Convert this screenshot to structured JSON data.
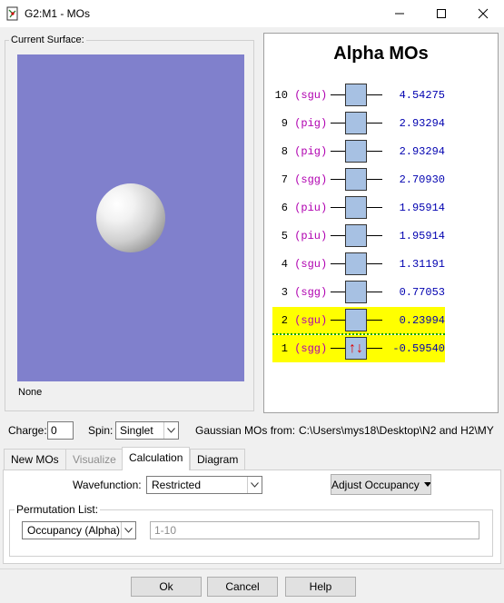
{
  "window": {
    "title": "G2:M1 - MOs"
  },
  "surface": {
    "legend": "Current Surface:",
    "status": "None"
  },
  "mo_panel": {
    "title": "Alpha MOs",
    "orbitals": [
      {
        "num": "10",
        "sym": "(sgu)",
        "energy": "4.54275",
        "occupied": false
      },
      {
        "num": "9",
        "sym": "(pig)",
        "energy": "2.93294",
        "occupied": false
      },
      {
        "num": "8",
        "sym": "(pig)",
        "energy": "2.93294",
        "occupied": false
      },
      {
        "num": "7",
        "sym": "(sgg)",
        "energy": "2.70930",
        "occupied": false
      },
      {
        "num": "6",
        "sym": "(piu)",
        "energy": "1.95914",
        "occupied": false
      },
      {
        "num": "5",
        "sym": "(piu)",
        "energy": "1.95914",
        "occupied": false
      },
      {
        "num": "4",
        "sym": "(sgu)",
        "energy": "1.31191",
        "occupied": false
      },
      {
        "num": "3",
        "sym": "(sgg)",
        "energy": "0.77053",
        "occupied": false
      },
      {
        "num": "2",
        "sym": "(sgu)",
        "energy": "0.23994",
        "occupied": false
      },
      {
        "num": "1",
        "sym": "(sgg)",
        "energy": "-0.59540",
        "occupied": true
      }
    ],
    "colors": {
      "highlight": "#ffff00",
      "symmetry": "#b000b0",
      "energy": "#0000b0",
      "box": "#a7c1e3",
      "electron": "#e00000"
    }
  },
  "controls": {
    "charge_label": "Charge:",
    "charge_value": "0",
    "spin_label": "Spin:",
    "spin_value": "Singlet",
    "gaussian_label": "Gaussian MOs from:",
    "gaussian_path": "C:\\Users\\mys18\\Desktop\\N2 and H2\\MY"
  },
  "tabs": [
    {
      "label": "New MOs",
      "state": "normal"
    },
    {
      "label": "Visualize",
      "state": "disabled"
    },
    {
      "label": "Calculation",
      "state": "active"
    },
    {
      "label": "Diagram",
      "state": "normal"
    }
  ],
  "calculation": {
    "wavefunction_label": "Wavefunction:",
    "wavefunction_value": "Restricted",
    "adjust_button": "Adjust Occupancy",
    "permutation_legend": "Permutation List:",
    "permutation_select": "Occupancy (Alpha)",
    "permutation_range": "1-10"
  },
  "buttons": {
    "ok": "Ok",
    "cancel": "Cancel",
    "help": "Help"
  }
}
